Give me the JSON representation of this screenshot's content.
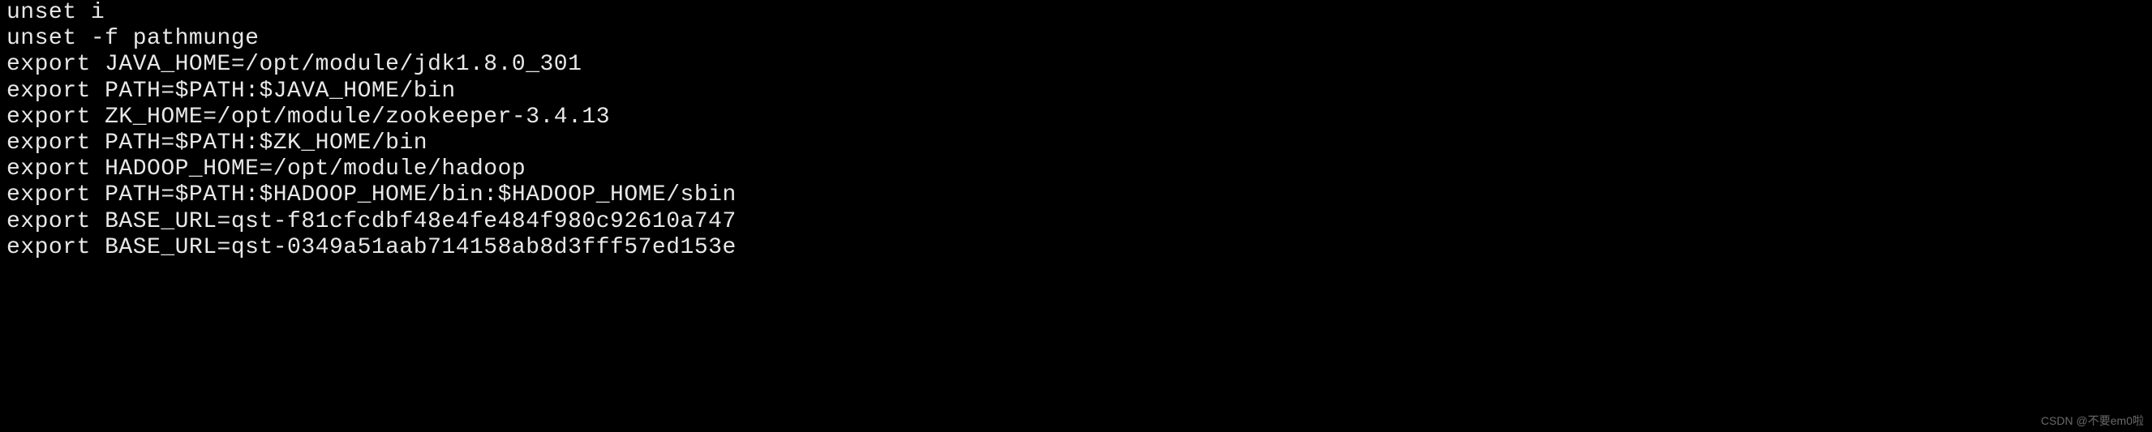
{
  "terminal": {
    "lines": [
      "unset i",
      "unset -f pathmunge",
      "export JAVA_HOME=/opt/module/jdk1.8.0_301",
      "export PATH=$PATH:$JAVA_HOME/bin",
      "export ZK_HOME=/opt/module/zookeeper-3.4.13",
      "export PATH=$PATH:$ZK_HOME/bin",
      "export HADOOP_HOME=/opt/module/hadoop",
      "export PATH=$PATH:$HADOOP_HOME/bin:$HADOOP_HOME/sbin",
      "export BASE_URL=qst-f81cfcdbf48e4fe484f980c92610a747",
      "export BASE_URL=qst-0349a51aab714158ab8d3fff57ed153e"
    ]
  },
  "watermark": {
    "text": "CSDN @不要em0啦"
  }
}
